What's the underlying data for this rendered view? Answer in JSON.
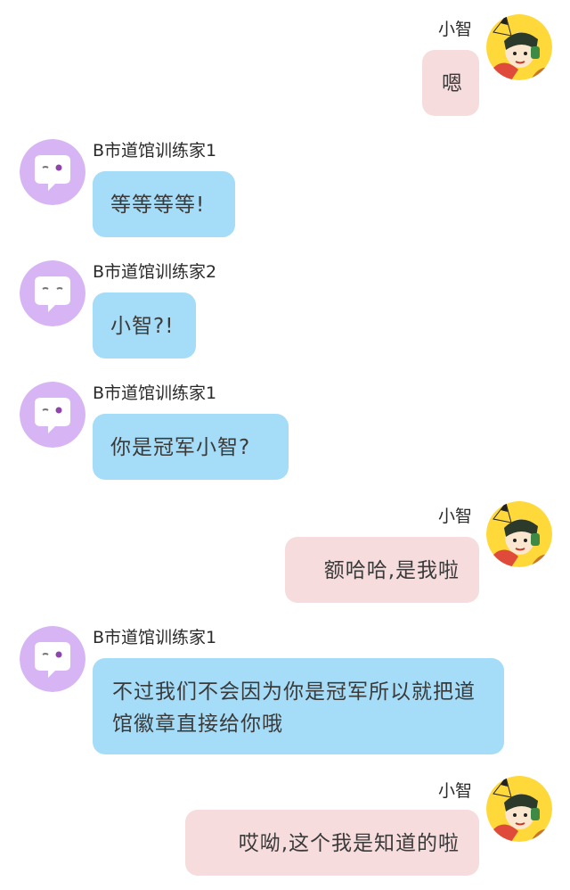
{
  "colors": {
    "left_bubble": "#a5dcf7",
    "right_bubble": "#f6dcdc",
    "left_avatar": "#d7b4f3",
    "right_avatar_bg": "#ffd83a"
  },
  "icons": {
    "left_avatar": "chat-bubble-face-icon",
    "right_avatar": "pikachu-hoodie-character-avatar"
  },
  "messages": [
    {
      "side": "right",
      "sender": "小智",
      "text": "嗯"
    },
    {
      "side": "left",
      "sender": "B市道馆训练家1",
      "text": "等等等等!"
    },
    {
      "side": "left",
      "sender": "B市道馆训练家2",
      "text": "小智?!"
    },
    {
      "side": "left",
      "sender": "B市道馆训练家1",
      "text": "你是冠军小智?"
    },
    {
      "side": "right",
      "sender": "小智",
      "text": "额哈哈,是我啦"
    },
    {
      "side": "left",
      "sender": "B市道馆训练家1",
      "text": "不过我们不会因为你是冠军所以就把道馆徽章直接给你哦"
    },
    {
      "side": "right",
      "sender": "小智",
      "text": "哎呦,这个我是知道的啦"
    }
  ]
}
